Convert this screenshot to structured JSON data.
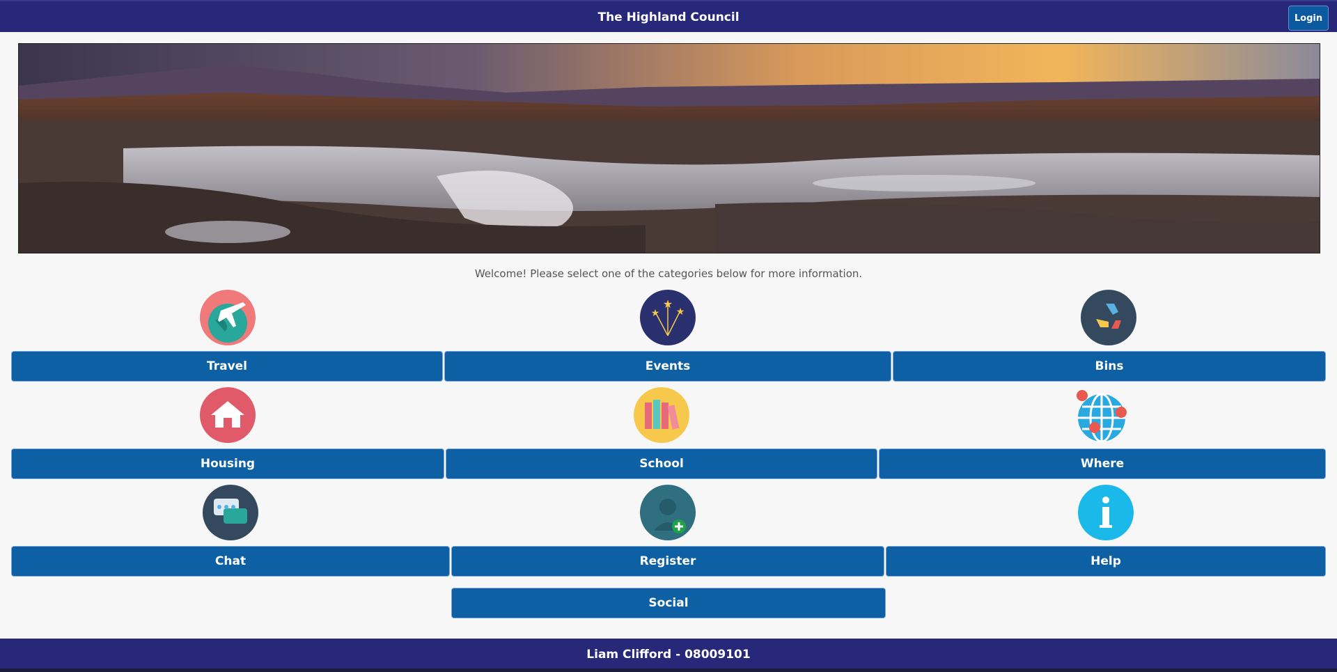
{
  "header": {
    "title": "The Highland Council",
    "login_label": "Login"
  },
  "welcome_text": "Welcome! Please select one of the categories below for more information.",
  "categories": [
    {
      "label": "Travel",
      "icon": "travel-globe-plane-icon"
    },
    {
      "label": "Events",
      "icon": "fireworks-icon"
    },
    {
      "label": "Bins",
      "icon": "recycle-icon"
    },
    {
      "label": "Housing",
      "icon": "house-icon"
    },
    {
      "label": "School",
      "icon": "books-icon"
    },
    {
      "label": "Where",
      "icon": "globe-pins-icon"
    },
    {
      "label": "Chat",
      "icon": "chat-bubbles-icon"
    },
    {
      "label": "Register",
      "icon": "add-user-icon"
    },
    {
      "label": "Help",
      "icon": "info-icon"
    },
    {
      "label": "Social"
    }
  ],
  "footer": {
    "text": "Liam Clifford - 08009101"
  },
  "colors": {
    "header_bg": "#27287a",
    "button_bg": "#0d60a3"
  }
}
